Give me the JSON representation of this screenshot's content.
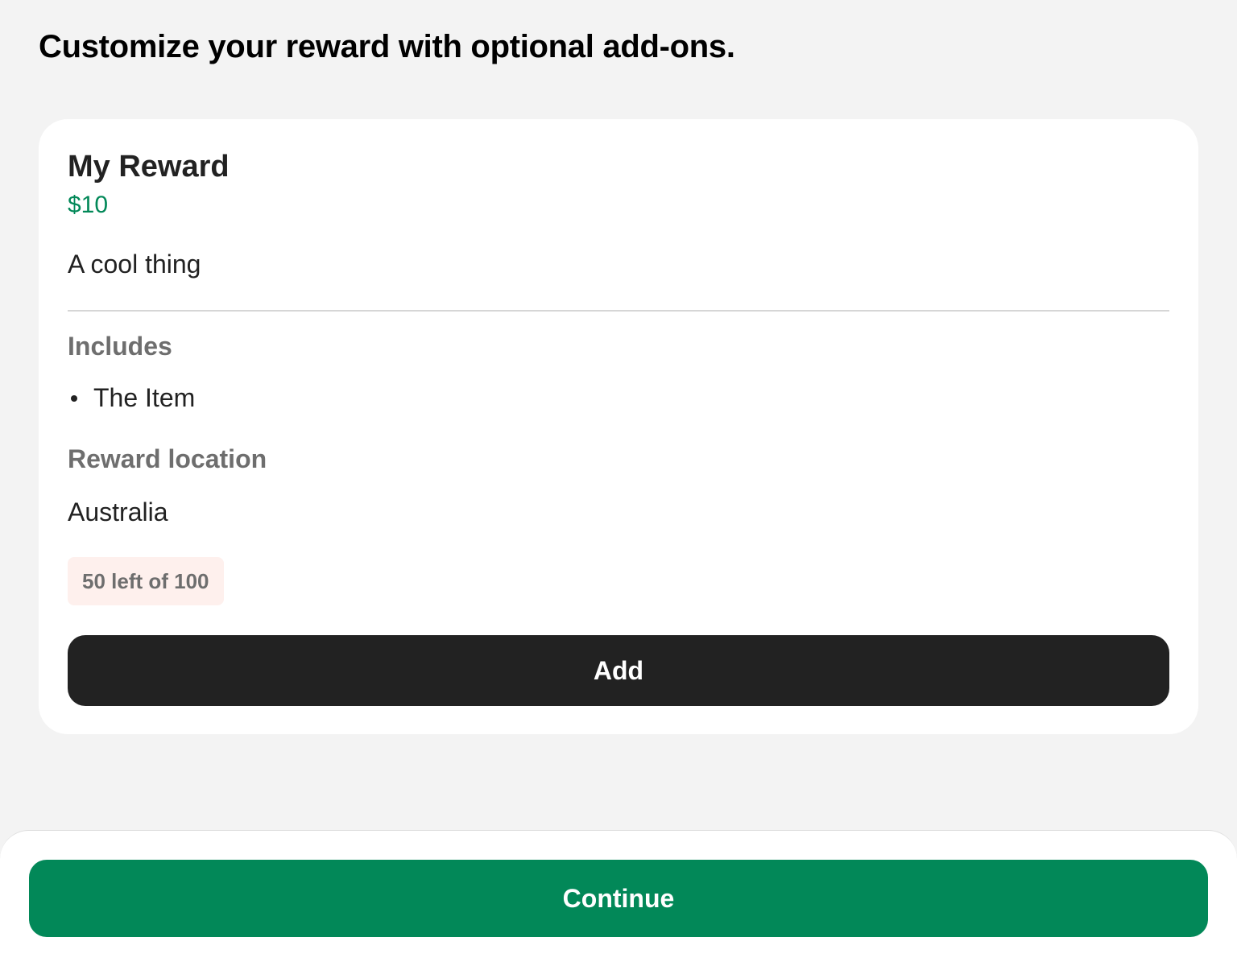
{
  "page": {
    "heading": "Customize your reward with optional add-ons."
  },
  "reward": {
    "title": "My Reward",
    "price": "$10",
    "description": "A cool thing",
    "includes_label": "Includes",
    "includes": [
      "The Item"
    ],
    "location_label": "Reward location",
    "location": "Australia",
    "limit_text": "50 left of 100",
    "add_label": "Add"
  },
  "footer": {
    "continue_label": "Continue"
  },
  "colors": {
    "accent_green": "#028858",
    "dark_button": "#222222",
    "badge_background": "#fef0ed",
    "page_background": "#f3f3f3"
  }
}
